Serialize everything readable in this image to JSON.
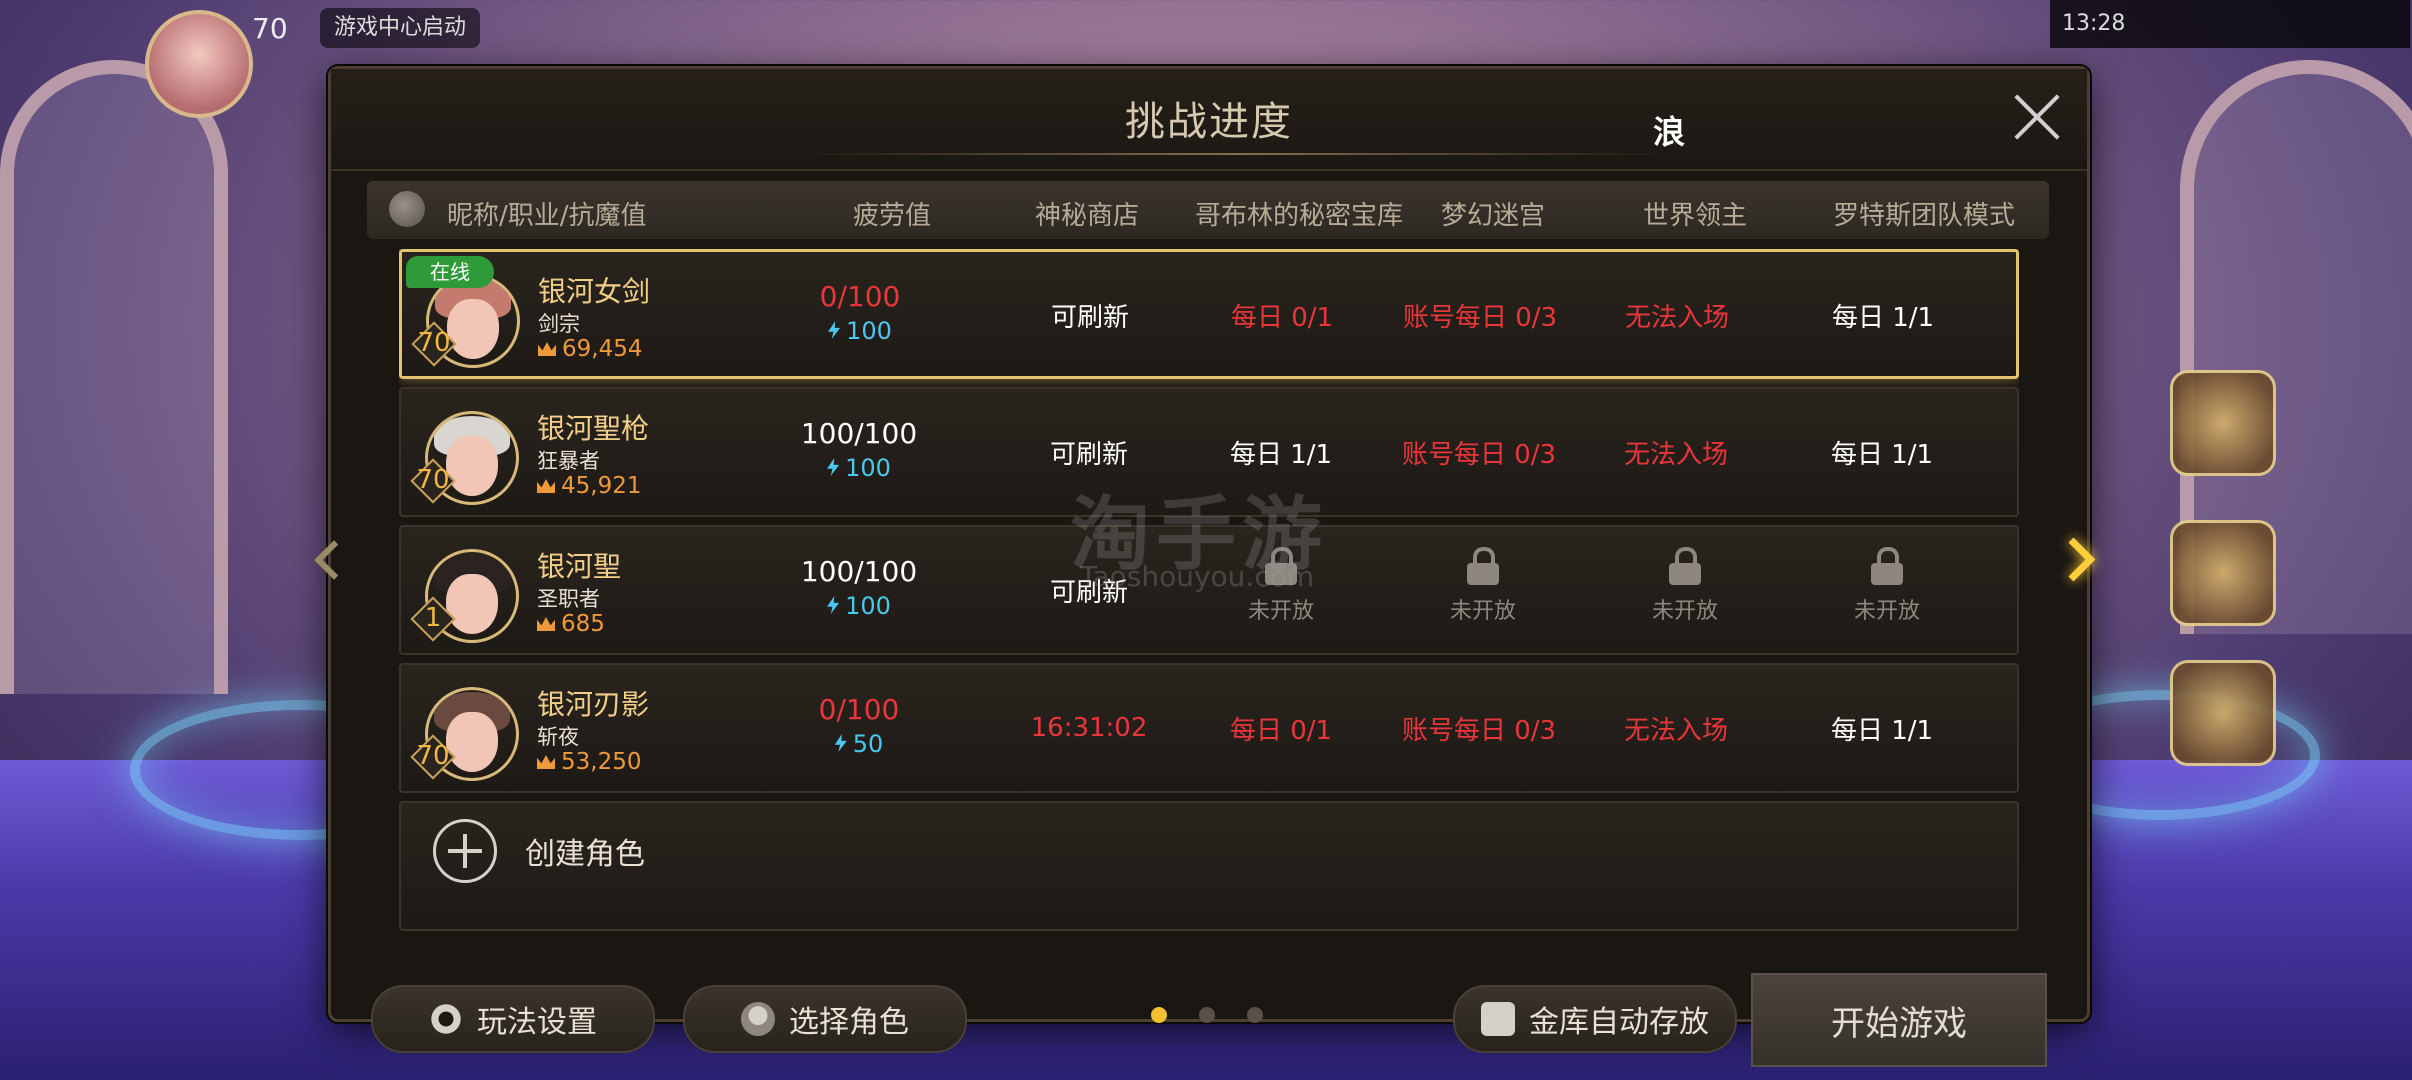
{
  "hud": {
    "level": "70",
    "center_button": "游戏中心启动",
    "status": "13:28"
  },
  "modal": {
    "title": "挑战进度",
    "mark": "浪",
    "headers": [
      "昵称/职业/抗魔值",
      "疲劳值",
      "神秘商店",
      "哥布林的秘密宝库",
      "梦幻迷宫",
      "世界领主",
      "罗特斯团队模式"
    ]
  },
  "characters": [
    {
      "online": "在线",
      "name": "银河女剑",
      "job": "剑宗",
      "level": "70",
      "power": "69,454",
      "fatigue": "0/100",
      "fatigue_red": true,
      "energy": "100",
      "shop": "可刷新",
      "goblin": "每日 0/1",
      "maze": "账号每日 0/3",
      "world_boss": "无法入场",
      "rotes": "每日 1/1"
    },
    {
      "name": "银河聖枪",
      "job": "狂暴者",
      "level": "70",
      "power": "45,921",
      "fatigue": "100/100",
      "fatigue_red": false,
      "energy": "100",
      "shop": "可刷新",
      "goblin": "每日 1/1",
      "maze": "账号每日 0/3",
      "world_boss": "无法入场",
      "rotes": "每日 1/1"
    },
    {
      "name": "银河聖",
      "job": "圣职者",
      "level": "1",
      "power": "685",
      "fatigue": "100/100",
      "fatigue_red": false,
      "energy": "100",
      "shop": "可刷新",
      "locked_label": "未开放"
    },
    {
      "name": "银河刃影",
      "job": "斩夜",
      "level": "70",
      "power": "53,250",
      "fatigue": "0/100",
      "fatigue_red": true,
      "energy": "50",
      "shop": "16:31:02",
      "goblin": "每日 0/1",
      "maze": "账号每日 0/3",
      "world_boss": "无法入场",
      "rotes": "每日 1/1"
    }
  ],
  "create": {
    "label": "创建角色"
  },
  "footer": {
    "settings": "玩法设置",
    "select_char": "选择角色",
    "vault_auto": "金库自动存放",
    "start": "开始游戏",
    "page_count": 3,
    "active_page": 1
  },
  "watermark": {
    "main": "淘手游",
    "sub": "Taoshouyou.com"
  },
  "colors": {
    "accent_gold": "#e2c46e",
    "red": "#e8363b",
    "energy": "#49c9ef",
    "online": "#2f9a3a"
  }
}
